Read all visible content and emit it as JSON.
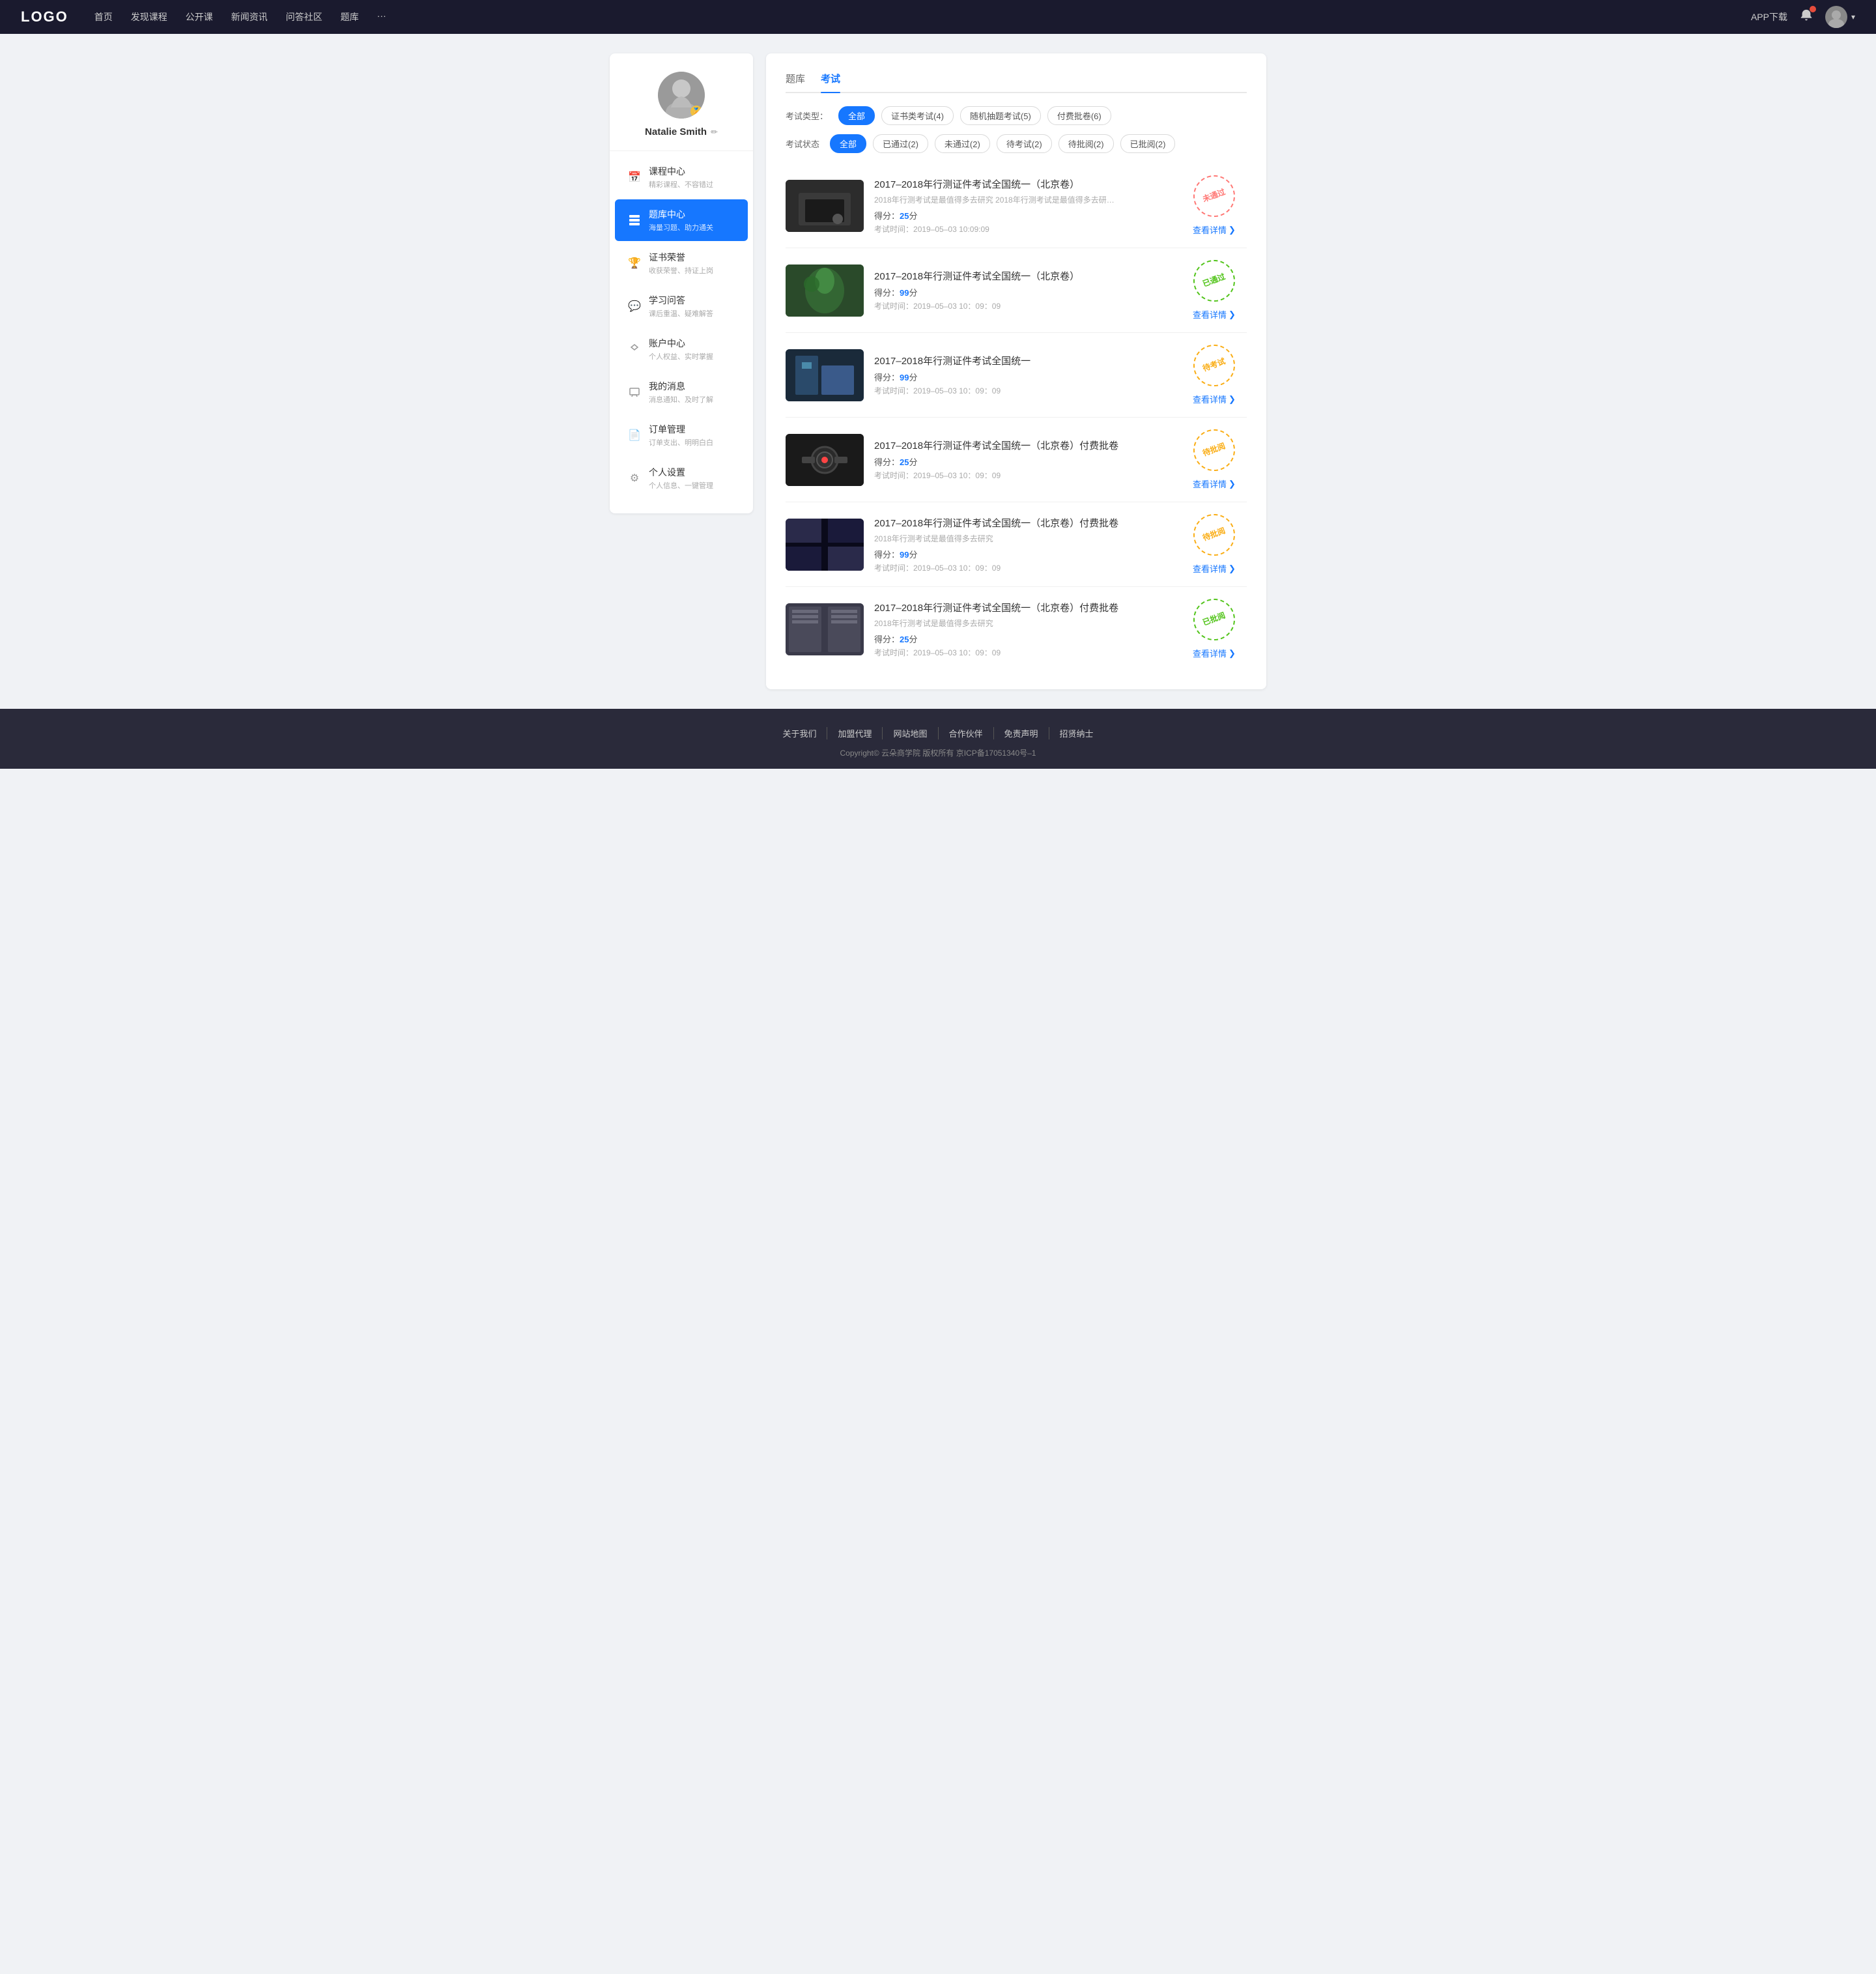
{
  "header": {
    "logo": "LOGO",
    "nav": [
      {
        "label": "首页",
        "id": "home"
      },
      {
        "label": "发现课程",
        "id": "discover"
      },
      {
        "label": "公开课",
        "id": "opencourse"
      },
      {
        "label": "新闻资讯",
        "id": "news"
      },
      {
        "label": "问答社区",
        "id": "qa"
      },
      {
        "label": "题库",
        "id": "questionbank"
      },
      {
        "label": "···",
        "id": "more"
      }
    ],
    "app_download": "APP下载",
    "user_dropdown_arrow": "▾"
  },
  "sidebar": {
    "profile": {
      "name": "Natalie Smith",
      "badge_icon": "🏅"
    },
    "menu": [
      {
        "id": "course-center",
        "label": "课程中心",
        "sub": "精彩课程、不容错过",
        "icon": "📅",
        "active": false
      },
      {
        "id": "question-bank",
        "label": "题库中心",
        "sub": "海量习题、助力通关",
        "icon": "📋",
        "active": true
      },
      {
        "id": "certificate",
        "label": "证书荣誉",
        "sub": "收获荣誉、持证上岗",
        "icon": "🏆",
        "active": false
      },
      {
        "id": "qa-center",
        "label": "学习问答",
        "sub": "课后重温、疑难解答",
        "icon": "💬",
        "active": false
      },
      {
        "id": "account",
        "label": "账户中心",
        "sub": "个人权益、实时掌握",
        "icon": "♡",
        "active": false
      },
      {
        "id": "messages",
        "label": "我的消息",
        "sub": "消息通知、及时了解",
        "icon": "💬",
        "active": false
      },
      {
        "id": "orders",
        "label": "订单管理",
        "sub": "订单支出、明明白白",
        "icon": "📄",
        "active": false
      },
      {
        "id": "settings",
        "label": "个人设置",
        "sub": "个人信息、一键管理",
        "icon": "⚙",
        "active": false
      }
    ]
  },
  "content": {
    "tabs": [
      {
        "label": "题库",
        "active": false
      },
      {
        "label": "考试",
        "active": true
      }
    ],
    "filter_type": {
      "label": "考试类型：",
      "options": [
        {
          "label": "全部",
          "active": true
        },
        {
          "label": "证书类考试(4)",
          "active": false
        },
        {
          "label": "随机抽题考试(5)",
          "active": false
        },
        {
          "label": "付费批卷(6)",
          "active": false
        }
      ]
    },
    "filter_status": {
      "label": "考试状态",
      "options": [
        {
          "label": "全部",
          "active": true
        },
        {
          "label": "已通过(2)",
          "active": false
        },
        {
          "label": "未通过(2)",
          "active": false
        },
        {
          "label": "待考试(2)",
          "active": false
        },
        {
          "label": "待批阅(2)",
          "active": false
        },
        {
          "label": "已批阅(2)",
          "active": false
        }
      ]
    },
    "exams": [
      {
        "id": "exam1",
        "thumb_class": "thumb-1",
        "title": "2017–2018年行测证件考试全国统一（北京卷）",
        "desc": "2018年行测考试是最值得多去研究 2018年行测考试是最值得多去研究 2018年行…",
        "score_label": "得分：",
        "score": "25",
        "score_unit": "分",
        "time_label": "考试时间：",
        "time": "2019–05–03  10:09:09",
        "status": "未通过",
        "stamp_class": "stamp-notpassed",
        "view_label": "查看详情"
      },
      {
        "id": "exam2",
        "thumb_class": "thumb-2",
        "title": "2017–2018年行测证件考试全国统一（北京卷）",
        "desc": "",
        "score_label": "得分：",
        "score": "99",
        "score_unit": "分",
        "time_label": "考试时间：",
        "time": "2019–05–03  10：09：09",
        "status": "已通过",
        "stamp_class": "stamp-passed",
        "view_label": "查看详情"
      },
      {
        "id": "exam3",
        "thumb_class": "thumb-3",
        "title": "2017–2018年行测证件考试全国统一",
        "desc": "",
        "score_label": "得分：",
        "score": "99",
        "score_unit": "分",
        "time_label": "考试时间：",
        "time": "2019–05–03  10：09：09",
        "status": "待考试",
        "stamp_class": "stamp-pending",
        "view_label": "查看详情"
      },
      {
        "id": "exam4",
        "thumb_class": "thumb-4",
        "title": "2017–2018年行测证件考试全国统一（北京卷）付费批卷",
        "desc": "",
        "score_label": "得分：",
        "score": "25",
        "score_unit": "分",
        "time_label": "考试时间：",
        "time": "2019–05–03  10：09：09",
        "status": "待批阅",
        "stamp_class": "stamp-pending-review",
        "view_label": "查看详情"
      },
      {
        "id": "exam5",
        "thumb_class": "thumb-5",
        "title": "2017–2018年行测证件考试全国统一（北京卷）付费批卷",
        "desc": "2018年行测考试是最值得多去研究",
        "score_label": "得分：",
        "score": "99",
        "score_unit": "分",
        "time_label": "考试时间：",
        "time": "2019–05–03  10：09：09",
        "status": "待批阅",
        "stamp_class": "stamp-pending-review",
        "view_label": "查看详情"
      },
      {
        "id": "exam6",
        "thumb_class": "thumb-6",
        "title": "2017–2018年行测证件考试全国统一（北京卷）付费批卷",
        "desc": "2018年行测考试是最值得多去研究",
        "score_label": "得分：",
        "score": "25",
        "score_unit": "分",
        "time_label": "考试时间：",
        "time": "2019–05–03  10：09：09",
        "status": "已批阅",
        "stamp_class": "stamp-reviewed",
        "view_label": "查看详情"
      }
    ]
  },
  "footer": {
    "links": [
      {
        "label": "关于我们"
      },
      {
        "label": "加盟代理"
      },
      {
        "label": "网站地图"
      },
      {
        "label": "合作伙伴"
      },
      {
        "label": "免责声明"
      },
      {
        "label": "招贤纳士"
      }
    ],
    "copyright": "Copyright© 云朵商学院  版权所有    京ICP备17051340号–1"
  }
}
